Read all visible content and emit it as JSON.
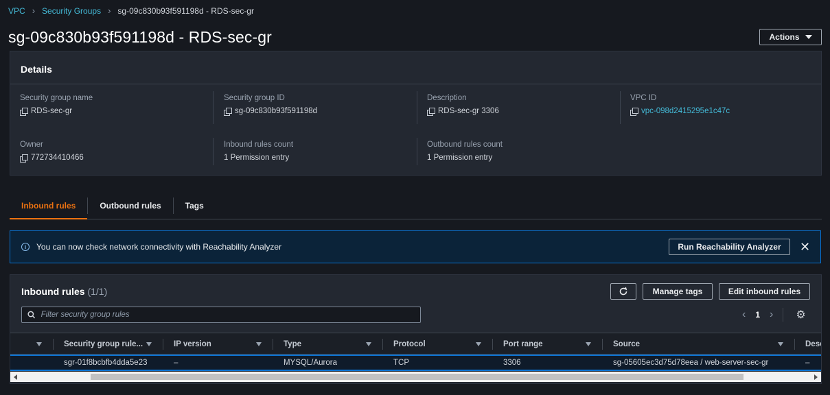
{
  "breadcrumb": {
    "items": [
      "VPC",
      "Security Groups"
    ],
    "current": "sg-09c830b93f591198d - RDS-sec-gr"
  },
  "page_title": "sg-09c830b93f591198d - RDS-sec-gr",
  "actions_label": "Actions",
  "details": {
    "heading": "Details",
    "fields": {
      "sg_name": {
        "label": "Security group name",
        "value": "RDS-sec-gr"
      },
      "sg_id": {
        "label": "Security group ID",
        "value": "sg-09c830b93f591198d"
      },
      "description": {
        "label": "Description",
        "value": "RDS-sec-gr 3306"
      },
      "vpc_id": {
        "label": "VPC ID",
        "value": "vpc-098d2415295e1c47c"
      },
      "owner": {
        "label": "Owner",
        "value": "772734410466"
      },
      "inbound_count": {
        "label": "Inbound rules count",
        "value": "1 Permission entry"
      },
      "outbound_count": {
        "label": "Outbound rules count",
        "value": "1 Permission entry"
      }
    }
  },
  "tabs": [
    {
      "label": "Inbound rules",
      "active": true
    },
    {
      "label": "Outbound rules",
      "active": false
    },
    {
      "label": "Tags",
      "active": false
    }
  ],
  "alert": {
    "text": "You can now check network connectivity with Reachability Analyzer",
    "button_label": "Run Reachability Analyzer"
  },
  "inbound_rules": {
    "title": "Inbound rules",
    "count": "(1/1)",
    "manage_tags_label": "Manage tags",
    "edit_label": "Edit inbound rules",
    "search_placeholder": "Filter security group rules",
    "page": "1",
    "columns": [
      "Security group rule...",
      "IP version",
      "Type",
      "Protocol",
      "Port range",
      "Source",
      "Desc"
    ],
    "rows": [
      {
        "rule_id": "sgr-01f8bcbfb4dda5e23",
        "ip_version": "–",
        "type": "MYSQL/Aurora",
        "protocol": "TCP",
        "port_range": "3306",
        "source": "sg-05605ec3d75d78eea / web-server-sec-gr",
        "desc": "–"
      }
    ]
  },
  "colors": {
    "background": "#16191f",
    "panel": "#232831",
    "accent_orange": "#ec7211",
    "link": "#44b9d6",
    "info_border": "#0972d3"
  }
}
